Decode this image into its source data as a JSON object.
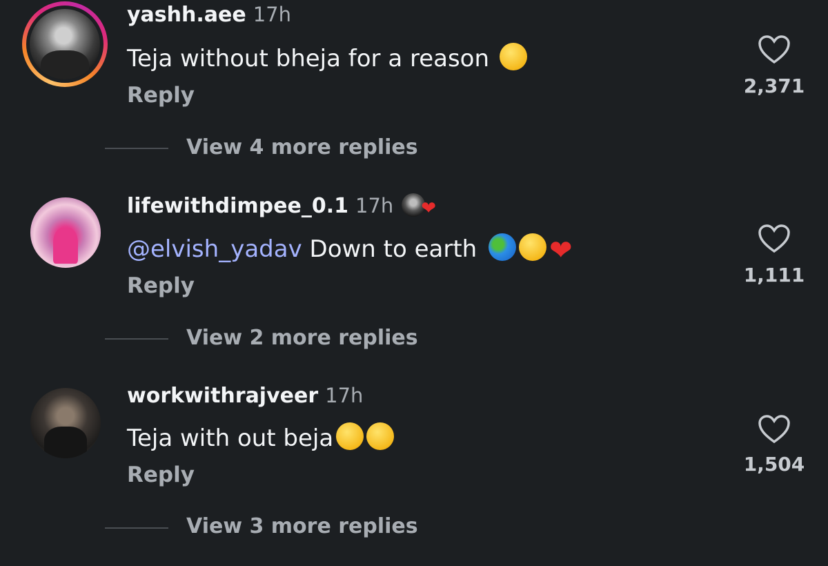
{
  "comments": [
    {
      "username": "yashh.aee",
      "time": "17h",
      "text": "Teja without bheja for a reason",
      "emojis": [
        "sleepy-face"
      ],
      "reply_label": "Reply",
      "view_replies": "View 4 more replies",
      "likes": "2,371",
      "has_story_ring": true
    },
    {
      "username": "lifewithdimpee_0.1",
      "time": "17h",
      "mention": "@elvish_yadav",
      "text": "Down to earth",
      "emojis": [
        "globe-emoji",
        "pleading-face",
        "red-heart"
      ],
      "creator_liked": true,
      "reply_label": "Reply",
      "view_replies": "View 2 more replies",
      "likes": "1,111",
      "has_story_ring": false
    },
    {
      "username": "workwithrajveer",
      "time": "17h",
      "text": "Teja with out beja",
      "emojis": [
        "tears-of-joy",
        "tears-of-joy"
      ],
      "reply_label": "Reply",
      "view_replies": "View 3 more replies",
      "likes": "1,504",
      "has_story_ring": false
    }
  ],
  "colors": {
    "background": "#1c1f22",
    "text_primary": "#f3f5f7",
    "text_secondary": "#a8adb3",
    "mention": "#a4b3ff",
    "heart_red": "#e62b2b"
  }
}
